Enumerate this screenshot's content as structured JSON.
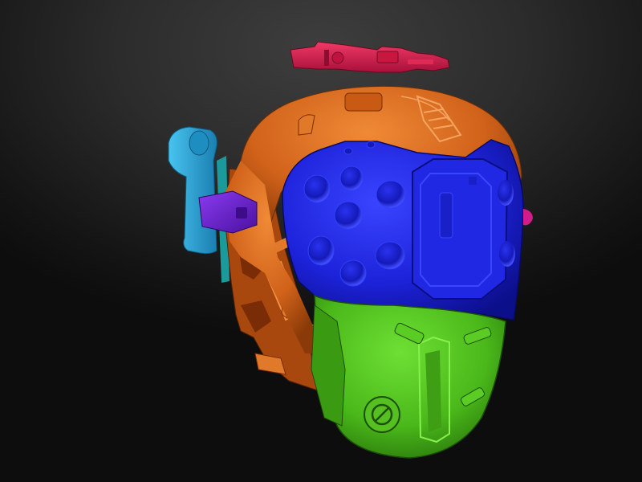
{
  "scene": {
    "subject": "helmet-3d-model",
    "colors": {
      "background_top": "#3e3e3e",
      "background_bottom": "#0d0d0d",
      "shell_orange": "#d8681a",
      "visor_blue": "#1c22d8",
      "mask_green": "#4fc51b",
      "antenna_red": "#d81c4a",
      "side_cyan": "#2aa6d6",
      "side_purple": "#6a1ec8",
      "accent_magenta": "#d21c8a"
    }
  }
}
